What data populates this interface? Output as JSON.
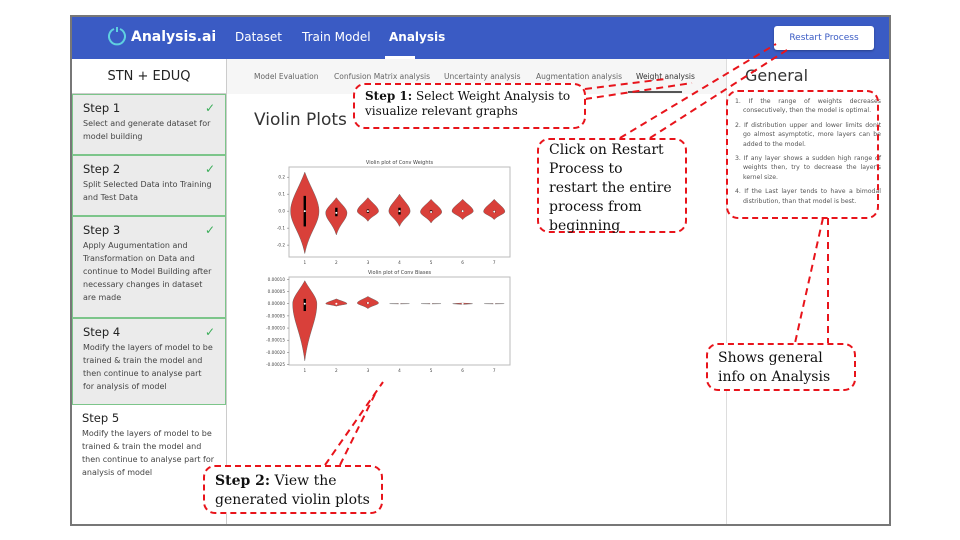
{
  "nav": {
    "brand": "Analysis.ai",
    "links": [
      "Dataset",
      "Train Model",
      "Analysis"
    ],
    "active": "Analysis",
    "restart": "Restart Process"
  },
  "sidebar": {
    "title": "STN + EDUQ",
    "steps": [
      {
        "title": "Step 1",
        "desc": "Select and generate dataset for model building",
        "done": true
      },
      {
        "title": "Step 2",
        "desc": "Split Selected Data into Training and Test Data",
        "done": true
      },
      {
        "title": "Step 3",
        "desc": "Apply Augumentation and Transformation on Data and continue to Model Building after necessary changes in dataset are made",
        "done": true
      },
      {
        "title": "Step 4",
        "desc": "Modify the layers of model to be trained & train the model and then continue to analyse part for analysis of model",
        "done": true
      },
      {
        "title": "Step 5",
        "desc": "Modify the layers of model to be trained & train the model and then continue to analyse part for analysis of model",
        "done": false
      }
    ]
  },
  "tabs": [
    "Model Evaluation",
    "Confusion Matrix analysis",
    "Uncertainty analysis",
    "Augmentation analysis",
    "Weight analysis"
  ],
  "active_tab": "Weight analysis",
  "main": {
    "title": "Violin Plots"
  },
  "general": {
    "title": "General",
    "items": [
      "1. If the range of weights decreases consecutively, then the model is optimal.",
      "2. If distribution upper and lower limits don't go almost asymptotic, more layers can be added to the model.",
      "3. If any layer shows a sudden high range of weights then, try to decrease the layer's kernel size.",
      "4. If the Last layer tends to have a bimodal distribution, than that model is best."
    ]
  },
  "annotations": {
    "step1_bold": "Step 1:",
    "step1_text": " Select Weight Analysis to visualize relevant graphs",
    "restart": "Click on Restart Process to restart the entire process from beginning",
    "general": "Shows general info on Analysis",
    "step2_bold": "Step 2:",
    "step2_text": " View the generated violin plots"
  },
  "colors": {
    "nav": "#3a5bc4",
    "violin": "#d9403a",
    "annotation": "#e8141b",
    "check": "#3cae5a"
  },
  "chart_data": [
    {
      "type": "violin",
      "title": "Violin plot of Conv Weights",
      "categories": [
        "1",
        "2",
        "3",
        "4",
        "5",
        "6",
        "7"
      ],
      "yticks": [
        "0.2",
        "0.1",
        "0.0",
        "-0.1",
        "-0.2"
      ],
      "ytick_values": [
        0.2,
        0.1,
        0,
        -0.1,
        -0.2
      ],
      "ylim": [
        -0.27,
        0.26
      ],
      "violins": [
        {
          "min": -0.25,
          "max": 0.23,
          "q1": -0.09,
          "q3": 0.09,
          "median": 0,
          "width": 1.0
        },
        {
          "min": -0.14,
          "max": 0.08,
          "q1": -0.03,
          "q3": 0.02,
          "median": -0.01,
          "width": 0.75
        },
        {
          "min": -0.06,
          "max": 0.08,
          "q1": -0.01,
          "q3": 0.01,
          "median": 0,
          "width": 0.75
        },
        {
          "min": -0.09,
          "max": 0.1,
          "q1": -0.02,
          "q3": 0.02,
          "median": 0,
          "width": 0.75
        },
        {
          "min": -0.07,
          "max": 0.07,
          "q1": -0.01,
          "q3": 0.005,
          "median": -0.005,
          "width": 0.75
        },
        {
          "min": -0.05,
          "max": 0.07,
          "q1": -0.005,
          "q3": 0.005,
          "median": 0,
          "width": 0.75
        },
        {
          "min": -0.05,
          "max": 0.07,
          "q1": -0.008,
          "q3": 0.003,
          "median": -0.003,
          "width": 0.75
        }
      ]
    },
    {
      "type": "violin",
      "title": "Violin plot of Conv Biases",
      "categories": [
        "1",
        "2",
        "3",
        "4",
        "5",
        "6",
        "7"
      ],
      "yticks": [
        "0.00010",
        "0.00005",
        "0.00000",
        "-0.00005",
        "-0.00010",
        "-0.00015",
        "-0.00020",
        "-0.00025"
      ],
      "ytick_values": [
        0.0001,
        5e-05,
        0,
        -5e-05,
        -0.0001,
        -0.00015,
        -0.0002,
        -0.00025
      ],
      "ylim": [
        -0.000252,
        0.00011
      ],
      "violins": [
        {
          "min": -0.000235,
          "max": 9.5e-05,
          "q1": -3e-05,
          "q3": 2e-05,
          "median": 0,
          "width": 0.85
        },
        {
          "min": -1e-05,
          "max": 2e-05,
          "q1": 0,
          "q3": 0,
          "median": 0,
          "width": 0.75
        },
        {
          "min": -2e-05,
          "max": 3e-05,
          "q1": 0,
          "q3": 5e-06,
          "median": 3e-06,
          "width": 0.75
        },
        {
          "min": -1e-06,
          "max": 1e-06,
          "q1": 0,
          "q3": 0,
          "median": 0,
          "width": 0.75
        },
        {
          "min": -1e-06,
          "max": 1e-06,
          "q1": 0,
          "q3": 0,
          "median": 0,
          "width": 0.75
        },
        {
          "min": -3e-06,
          "max": 3e-06,
          "q1": 0,
          "q3": 0,
          "median": 0,
          "width": 0.75
        },
        {
          "min": -1e-06,
          "max": 1e-06,
          "q1": 0,
          "q3": 0,
          "median": 0,
          "width": 0.75
        }
      ]
    }
  ]
}
